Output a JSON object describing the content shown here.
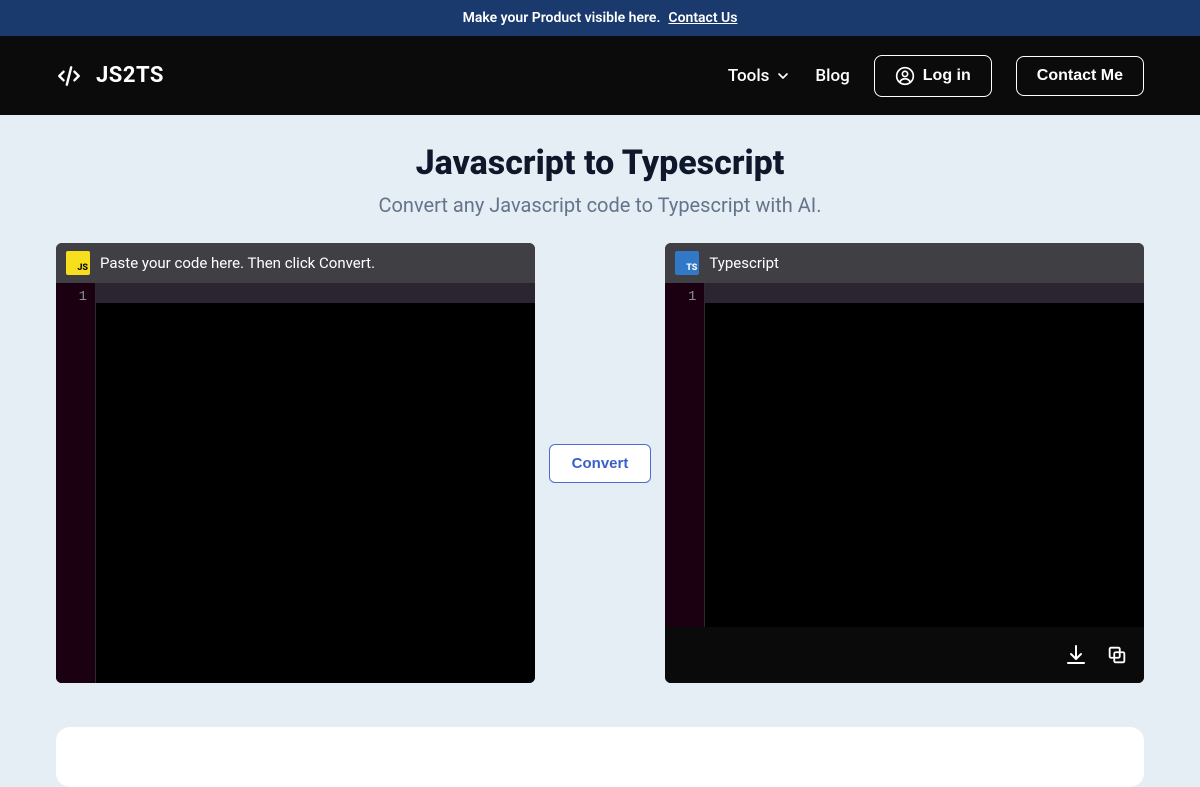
{
  "banner": {
    "text": "Make your Product visible here.",
    "link_label": "Contact Us"
  },
  "nav": {
    "brand": "JS2TS",
    "tools_label": "Tools",
    "blog_label": "Blog",
    "login_label": "Log in",
    "contact_label": "Contact Me"
  },
  "page": {
    "title": "Javascript to Typescript",
    "subtitle": "Convert any Javascript code to Typescript with AI."
  },
  "editor_left": {
    "badge": "JS",
    "title": "Paste your code here. Then click Convert.",
    "line1": "1",
    "value": ""
  },
  "editor_right": {
    "badge": "TS",
    "title": "Typescript",
    "line1": "1",
    "value": ""
  },
  "actions": {
    "convert": "Convert"
  }
}
